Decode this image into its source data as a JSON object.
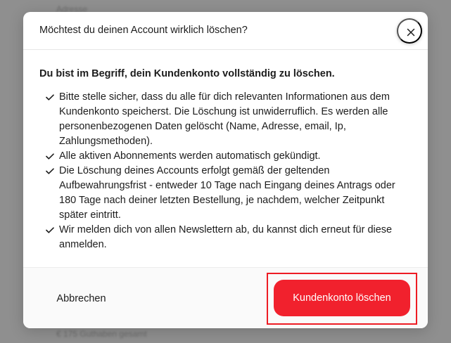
{
  "background": {
    "top_text": "Adresse",
    "bottom_text": "€ 175 Guthaben gesamt"
  },
  "dialog": {
    "title": "Möchtest du deinen Account wirklich löschen?",
    "close_icon": "close-icon",
    "lead": "Du bist im Begriff, dein Kundenkonto vollständig zu löschen.",
    "items": [
      {
        "line1": "Bitte stelle sicher, dass du alle für dich relevanten Informationen aus dem",
        "line2": "Kundenkonto speicherst. Die Löschung ist unwiderruflich. Es werden alle",
        "line3": "personenbezogenen Daten gelöscht (Name, Adresse, email, Ip,",
        "line4": "Zahlungsmethoden)."
      },
      {
        "line1": "Alle aktiven Abonnements werden automatisch gekündigt."
      },
      {
        "line1": "Die Löschung deines Accounts erfolgt gemäß der geltenden",
        "line2": "Aufbewahrungsfrist - entweder 10 Tage nach Eingang deines Antrags oder",
        "line3": "180 Tage nach deiner letzten Bestellung, je nachdem, welcher Zeitpunkt",
        "line4": "später eintritt."
      },
      {
        "line1": "Wir melden dich von allen Newslettern ab, du kannst dich erneut für diese",
        "line2": "anmelden."
      }
    ],
    "cancel_label": "Abbrechen",
    "delete_label": "Kundenkonto löschen"
  },
  "colors": {
    "accent": "#f1212d",
    "highlight_outline": "#ee1c24",
    "overlay": "#8f8f8f"
  }
}
